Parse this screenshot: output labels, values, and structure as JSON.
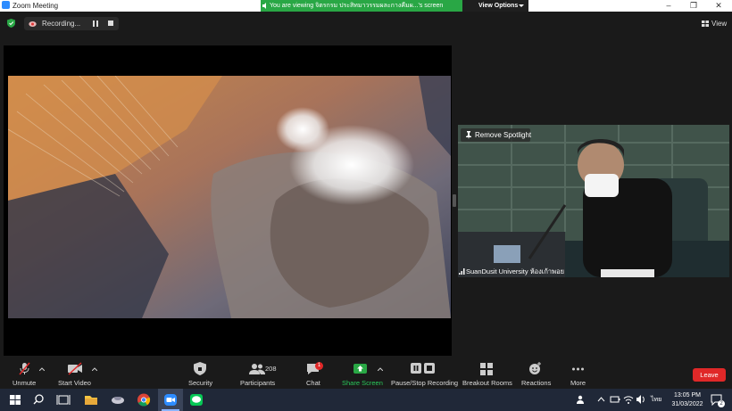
{
  "window": {
    "title": "Zoom Meeting",
    "minimize": "–",
    "restore": "❐",
    "close": "✕"
  },
  "share_banner": {
    "text": "You are viewing จิตรกรม ประสิทมาวรรมผละกางคืมผ...'s screen",
    "view_options_label": "View Options"
  },
  "meeting_top": {
    "recording_label": "Recording...",
    "view_label": "View"
  },
  "spotlight": {
    "remove_label": "Remove Spotlight",
    "participant_name": "SuanDusit University ห้องเก้าพอย"
  },
  "toolbar": {
    "unmute_label": "Unmute",
    "start_video_label": "Start Video",
    "security_label": "Security",
    "participants_label": "Participants",
    "participants_count": "208",
    "chat_label": "Chat",
    "chat_badge": "1",
    "share_screen_label": "Share Screen",
    "pause_stop_label": "Pause/Stop Recording",
    "breakout_label": "Breakout Rooms",
    "reactions_label": "Reactions",
    "more_label": "More",
    "leave_label": "Leave"
  },
  "taskbar": {
    "lang": "ไทย",
    "time": "13:05 PM",
    "date": "31/03/2022",
    "notif_count": "2"
  },
  "colors": {
    "accent_green": "#29a745",
    "leave_red": "#e02828",
    "zoom_blue": "#2d8cff"
  }
}
